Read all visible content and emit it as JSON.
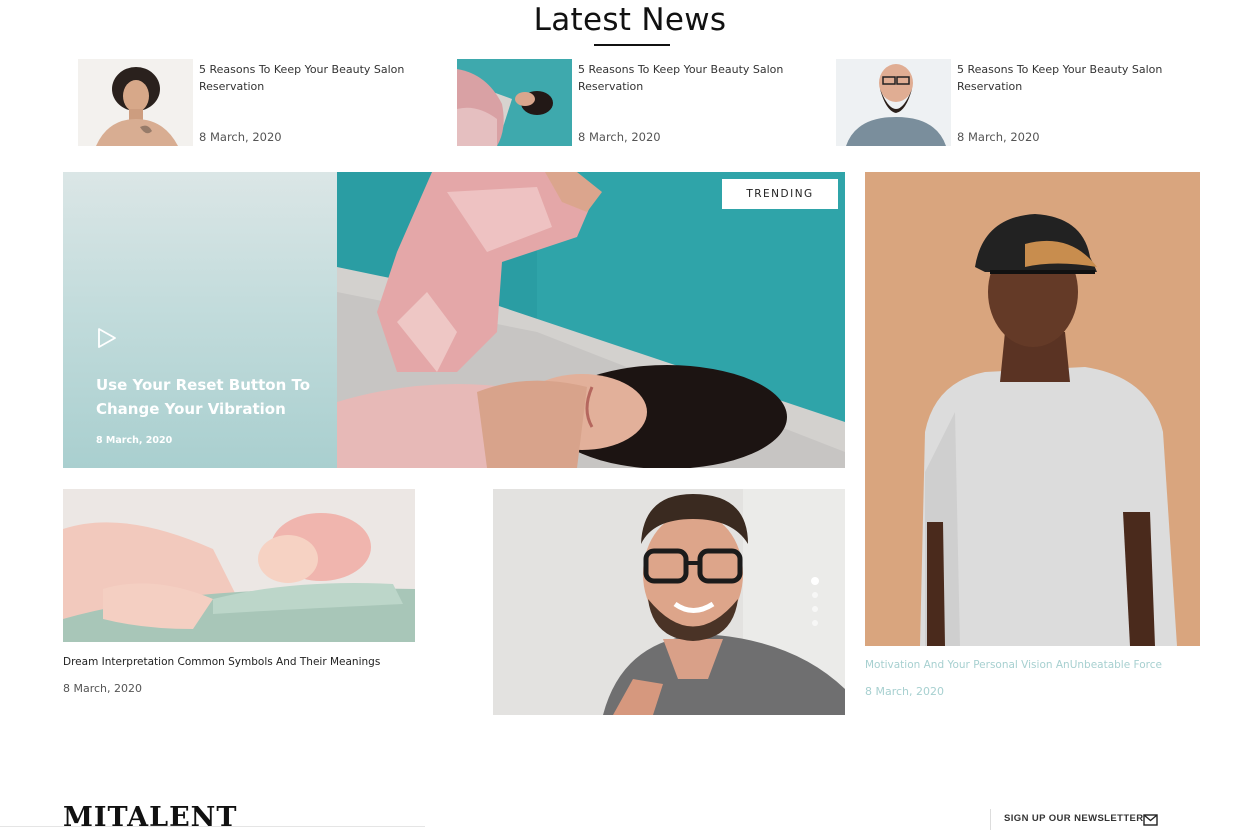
{
  "section": {
    "title": "Latest News"
  },
  "mini_posts": [
    {
      "title": "5 Reasons To Keep Your Beauty Salon Reservation",
      "date": "8 March, 2020"
    },
    {
      "title": "5 Reasons To Keep Your Beauty Salon Reservation",
      "date": "8 March, 2020"
    },
    {
      "title": "5 Reasons To Keep Your Beauty Salon Reservation",
      "date": "8 March, 2020"
    }
  ],
  "hero": {
    "badge": "TRENDING",
    "title": "Use Your Reset Button To Change Your Vibration",
    "date": "8 March, 2020",
    "icon": "play-icon"
  },
  "cards": [
    {
      "title": "Dream Interpretation Common Symbols And Their Meanings",
      "date": "8 March, 2020"
    },
    {
      "title": "Motivation And Your Personal Vision AnUnbeatable Force",
      "date": "8 March, 2020"
    }
  ],
  "slider": {
    "dot_count": 4,
    "active_index": 0
  },
  "footer": {
    "logo": "MITALENT",
    "newsletter_label": "SIGN UP OUR NEWSLETTER",
    "newsletter_icon": "mail-icon"
  },
  "colors": {
    "hero_panel": "#c3dcdc",
    "accent_teal": "#a7d0d0",
    "portrait_bg": "#d9a57e"
  }
}
